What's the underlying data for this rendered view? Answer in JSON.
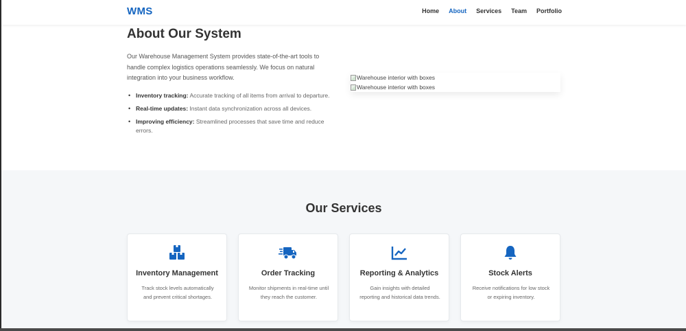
{
  "header": {
    "logo": "WMS",
    "nav": [
      {
        "label": "Home"
      },
      {
        "label": "About"
      },
      {
        "label": "Services"
      },
      {
        "label": "Team"
      },
      {
        "label": "Portfolio"
      }
    ],
    "active_nav": "About"
  },
  "about": {
    "title": "About Our System",
    "intro": "Our Warehouse Management System provides state-of-the-art tools to handle complex logistics operations seamlessly. We focus on natural integration into your business workflow.",
    "features": [
      {
        "label": "Inventory tracking:",
        "text": "Accurate tracking of all items from arrival to departure."
      },
      {
        "label": "Real-time updates:",
        "text": "Instant data synchronization across all devices."
      },
      {
        "label": "Improving efficiency:",
        "text": "Streamlined processes that save time and reduce errors."
      }
    ],
    "images": [
      {
        "alt": "Warehouse interior with boxes"
      },
      {
        "alt": "Warehouse interior with boxes"
      }
    ]
  },
  "services": {
    "title": "Our Services",
    "cards": [
      {
        "icon": "boxes-icon",
        "title": "Inventory Management",
        "text": "Track stock levels automatically and prevent critical shortages."
      },
      {
        "icon": "truck-fast-icon",
        "title": "Order Tracking",
        "text": "Monitor shipments in real-time until they reach the customer."
      },
      {
        "icon": "chart-line-icon",
        "title": "Reporting & Analytics",
        "text": "Gain insights with detailed reporting and historical data trends."
      },
      {
        "icon": "bell-icon",
        "title": "Stock Alerts",
        "text": "Receive notifications for low stock or expiring inventory."
      }
    ]
  },
  "colors": {
    "accent": "#1565c0",
    "services_bg": "#f5f7f9"
  }
}
